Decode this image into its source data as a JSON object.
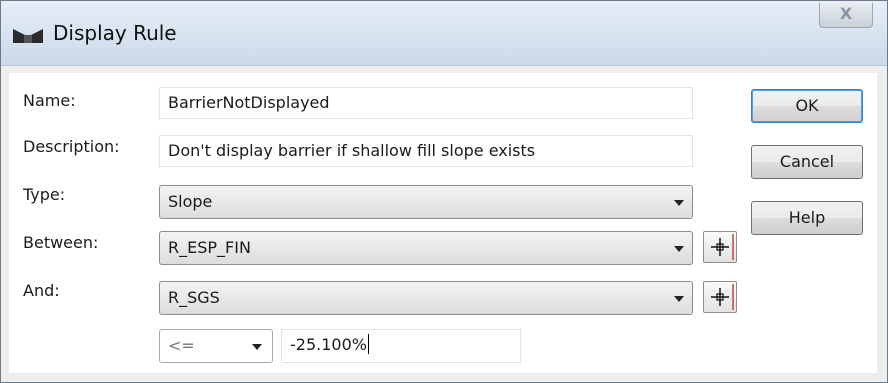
{
  "window": {
    "title": "Display Rule",
    "close_label": "X"
  },
  "fields": {
    "name": {
      "label": "Name:",
      "value": "BarrierNotDisplayed"
    },
    "description": {
      "label": "Description:",
      "value": "Don't display barrier if shallow fill slope exists"
    },
    "type": {
      "label": "Type:",
      "value": "Slope"
    },
    "between": {
      "label": "Between:",
      "value": "R_ESP_FIN"
    },
    "and": {
      "label": "And:",
      "value": "R_SGS"
    },
    "operator": {
      "value": "<="
    },
    "threshold": {
      "value": "-25.100%"
    }
  },
  "buttons": {
    "ok": "OK",
    "cancel": "Cancel",
    "help": "Help"
  },
  "icons": {
    "window_icon": "display-rule-icon",
    "pick": "crosshair-pick-icon",
    "dropdown": "chevron-down-icon"
  }
}
